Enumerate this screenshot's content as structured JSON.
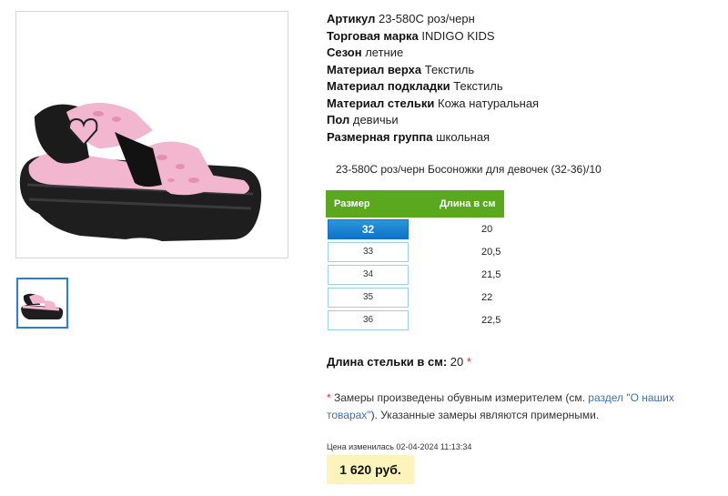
{
  "product": {
    "props": [
      {
        "label": "Артикул",
        "value": "23-580C роз/черн"
      },
      {
        "label": "Торговая марка",
        "value": "INDIGO KIDS"
      },
      {
        "label": "Сезон",
        "value": "летние"
      },
      {
        "label": "Материал верха",
        "value": "Текстиль"
      },
      {
        "label": "Материал подкладки",
        "value": "Текстиль"
      },
      {
        "label": "Материал стельки",
        "value": "Кожа натуральная"
      },
      {
        "label": "Пол",
        "value": "девичьи"
      },
      {
        "label": "Размерная группа",
        "value": "школьная"
      }
    ],
    "description": "23-580C роз/черн Босоножки для девочек (32-36)/10"
  },
  "sizes": {
    "header_size": "Размер",
    "header_length": "Длина в см",
    "rows": [
      {
        "size": "32",
        "length": "20",
        "active": true
      },
      {
        "size": "33",
        "length": "20,5"
      },
      {
        "size": "34",
        "length": "21,5"
      },
      {
        "size": "35",
        "length": "22"
      },
      {
        "size": "36",
        "length": "22,5"
      }
    ]
  },
  "insole": {
    "label": "Длина стельки в см:",
    "value": "20",
    "star": "*"
  },
  "note": {
    "star": "*",
    "text_before": " Замеры произведены обувным измерителем (см. ",
    "link": "раздел \"О наших товарах\"",
    "text_after": "). Указанные замеры являются примерными."
  },
  "price_changed": "Цена изменилась 02-04-2024 11:13:34",
  "price": "1 620 руб.",
  "colors": {
    "accent_green": "#5aa81e",
    "active_blue": "#1a80cf",
    "price_bg": "#fdf4bb",
    "shoe_pink": "#f2b6cf"
  }
}
